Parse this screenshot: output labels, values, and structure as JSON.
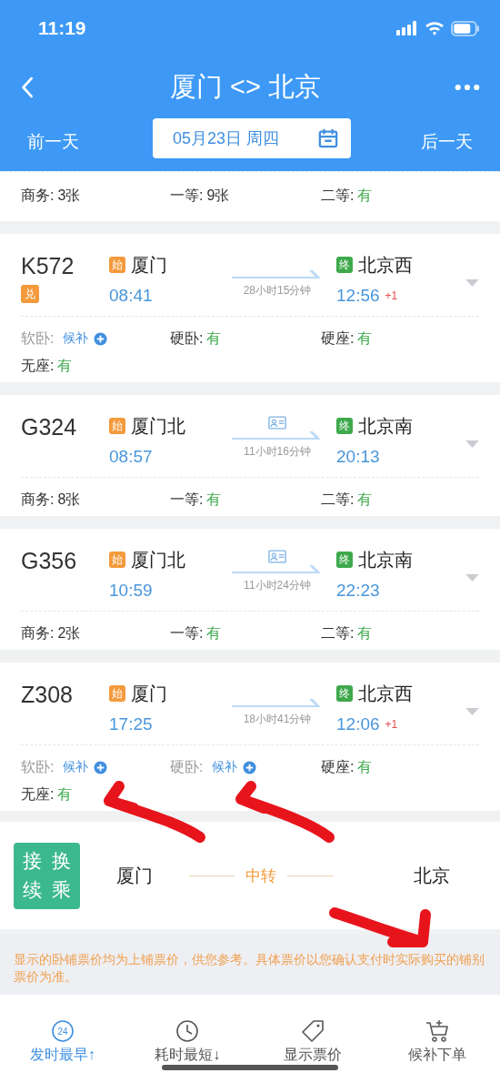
{
  "status_bar": {
    "time": "11:19"
  },
  "nav": {
    "title": "厦门 <> 北京"
  },
  "date_bar": {
    "prev": "前一天",
    "date": "05月23日 周四",
    "next": "后一天"
  },
  "partial_card": {
    "seats": [
      {
        "label": "商务:",
        "value": "3张",
        "kind": "count"
      },
      {
        "label": "一等:",
        "value": "9张",
        "kind": "count"
      },
      {
        "label": "二等:",
        "value": "有",
        "kind": "available"
      }
    ]
  },
  "trains": [
    {
      "number": "K572",
      "badge": "兑",
      "from": {
        "tag": "始",
        "station": "厦门",
        "time": "08:41"
      },
      "to": {
        "tag": "终",
        "station": "北京西",
        "time": "12:56",
        "plus_days": "+1"
      },
      "duration": "28小时15分钟",
      "id_card_icon": false,
      "seats": [
        {
          "label": "软卧:",
          "value": "候补",
          "kind": "waitlist"
        },
        {
          "label": "硬卧:",
          "value": "有",
          "kind": "available"
        },
        {
          "label": "硬座:",
          "value": "有",
          "kind": "available"
        },
        {
          "label": "无座:",
          "value": "有",
          "kind": "available"
        }
      ]
    },
    {
      "number": "G324",
      "from": {
        "tag": "始",
        "station": "厦门北",
        "time": "08:57"
      },
      "to": {
        "tag": "终",
        "station": "北京南",
        "time": "20:13"
      },
      "duration": "11小时16分钟",
      "id_card_icon": true,
      "seats": [
        {
          "label": "商务:",
          "value": "8张",
          "kind": "count"
        },
        {
          "label": "一等:",
          "value": "有",
          "kind": "available"
        },
        {
          "label": "二等:",
          "value": "有",
          "kind": "available"
        }
      ]
    },
    {
      "number": "G356",
      "from": {
        "tag": "始",
        "station": "厦门北",
        "time": "10:59"
      },
      "to": {
        "tag": "终",
        "station": "北京南",
        "time": "22:23"
      },
      "duration": "11小时24分钟",
      "id_card_icon": true,
      "seats": [
        {
          "label": "商务:",
          "value": "2张",
          "kind": "count"
        },
        {
          "label": "一等:",
          "value": "有",
          "kind": "available"
        },
        {
          "label": "二等:",
          "value": "有",
          "kind": "available"
        }
      ]
    },
    {
      "number": "Z308",
      "from": {
        "tag": "始",
        "station": "厦门",
        "time": "17:25"
      },
      "to": {
        "tag": "终",
        "station": "北京西",
        "time": "12:06",
        "plus_days": "+1"
      },
      "duration": "18小时41分钟",
      "id_card_icon": false,
      "seats": [
        {
          "label": "软卧:",
          "value": "候补",
          "kind": "waitlist"
        },
        {
          "label": "硬卧:",
          "value": "候补",
          "kind": "waitlist"
        },
        {
          "label": "硬座:",
          "value": "有",
          "kind": "available"
        },
        {
          "label": "无座:",
          "value": "有",
          "kind": "available"
        }
      ]
    }
  ],
  "transfer": {
    "badge_chars": [
      "接",
      "换",
      "续",
      "乘"
    ],
    "from": "厦门",
    "via": "中转",
    "to": "北京"
  },
  "note": "显示的卧铺票价均为上铺票价，供您参考。具体票价以您确认支付时实际购买的铺别票价为准。",
  "tabs": [
    {
      "label": "发时最早↑",
      "kind": "earliest",
      "icon_text": "24",
      "selected": true
    },
    {
      "label": "耗时最短↓",
      "kind": "shortest",
      "selected": false
    },
    {
      "label": "显示票价",
      "kind": "price",
      "selected": false
    },
    {
      "label": "候补下单",
      "kind": "waitlist",
      "selected": false
    }
  ]
}
